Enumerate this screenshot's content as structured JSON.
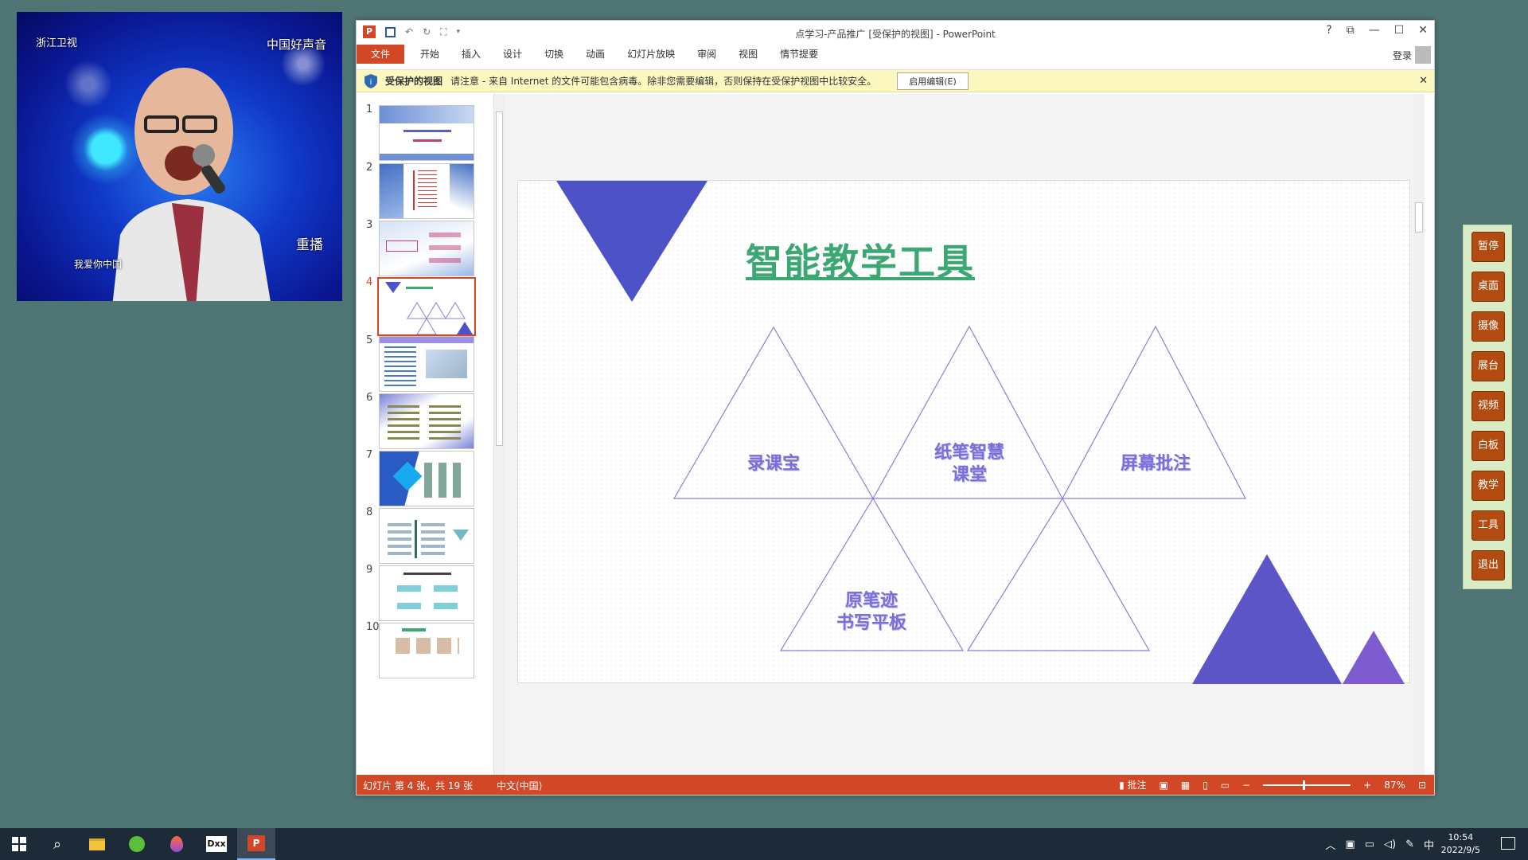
{
  "video": {
    "channel_logo": "浙江卫视",
    "show_brand": "中国好声音",
    "replay_label": "重播",
    "caption": "我爱你中国"
  },
  "window": {
    "title": "点学习-产品推广 [受保护的视图] - PowerPoint",
    "help": "?",
    "signin": "登录"
  },
  "ribbon": {
    "tabs": [
      "文件",
      "开始",
      "插入",
      "设计",
      "切换",
      "动画",
      "幻灯片放映",
      "审阅",
      "视图",
      "情节提要"
    ]
  },
  "protected_bar": {
    "label": "受保护的视图",
    "message": "请注意 - 来自 Internet 的文件可能包含病毒。除非您需要编辑，否则保持在受保护视图中比较安全。",
    "button": "启用编辑(E)",
    "close": "✕"
  },
  "thumbnails": {
    "numbers": [
      "1",
      "2",
      "3",
      "4",
      "5",
      "6",
      "7",
      "8",
      "9",
      "10"
    ],
    "selected_index": 3
  },
  "slide": {
    "title": "智能教学工具",
    "labels": {
      "t1": "录课宝",
      "t2a": "纸笔智慧",
      "t2b": "课堂",
      "t3": "屏幕批注",
      "t4a": "原笔迹",
      "t4b": "书写平板"
    },
    "colors": {
      "primary": "#4d53c6",
      "secondary": "#7f5bd0",
      "outline": "#8a7fd8",
      "title": "#3ba874"
    }
  },
  "status": {
    "slide_info": "幻灯片 第 4 张，共 19 张",
    "language": "中文(中国)",
    "notes": "批注",
    "zoom": "87%"
  },
  "sidebar": {
    "buttons": [
      "暂停",
      "桌面",
      "摄像",
      "展台",
      "视频",
      "白板",
      "教学",
      "工具",
      "退出"
    ]
  },
  "taskbar": {
    "time": "10:54",
    "date": "2022/9/5",
    "ime": "中"
  }
}
